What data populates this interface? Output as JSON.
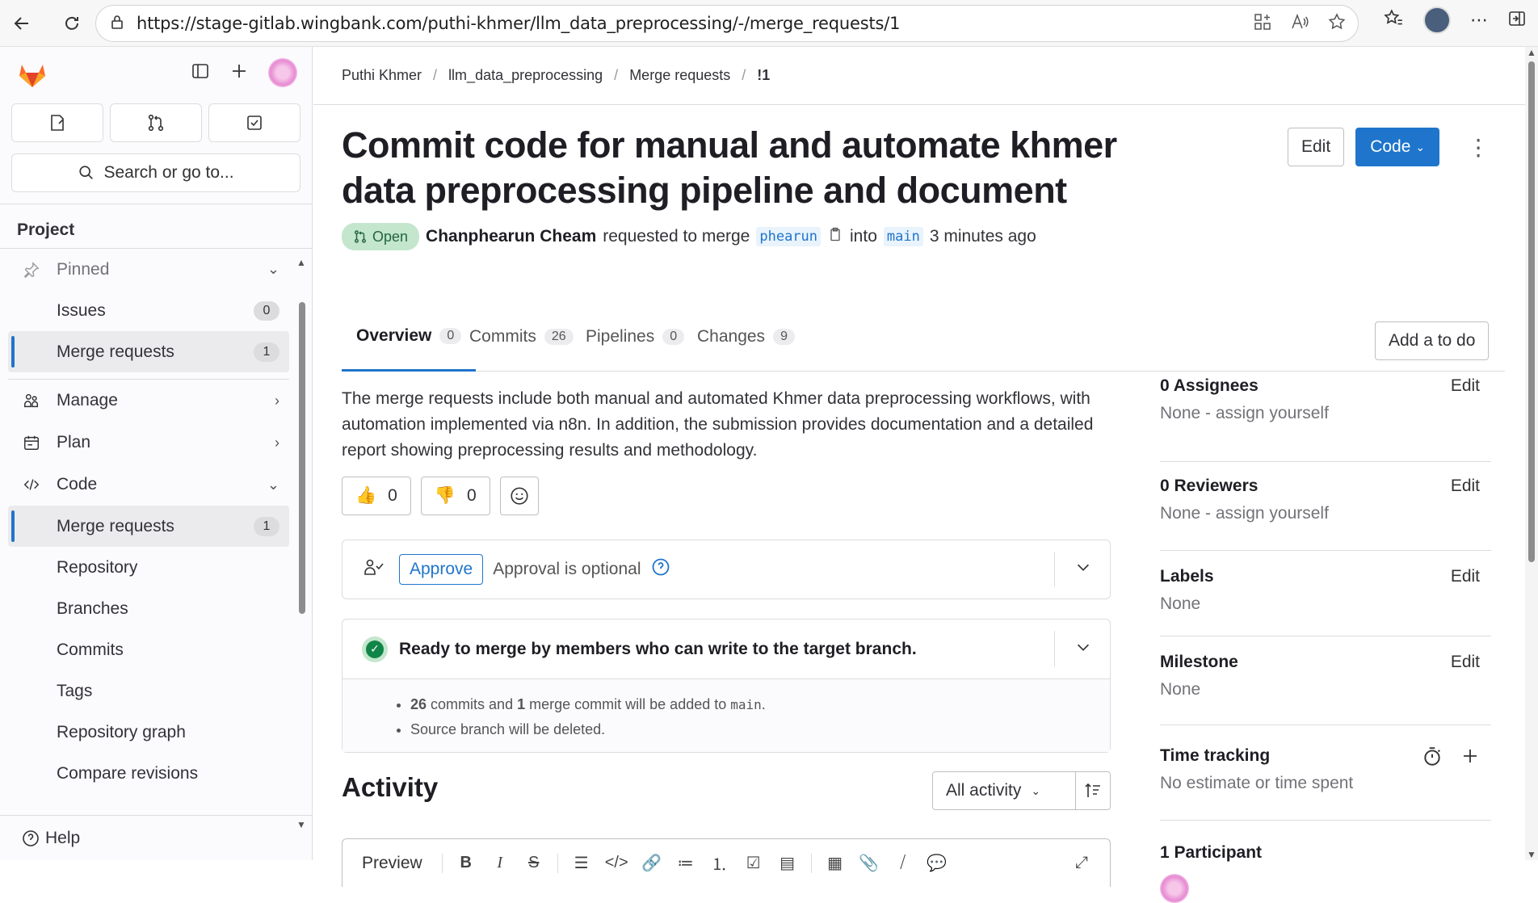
{
  "browser": {
    "url": "https://stage-gitlab.wingbank.com/puthi-khmer/llm_data_preprocessing/-/merge_requests/1"
  },
  "sidebar": {
    "search_placeholder": "Search or go to...",
    "section_title": "Project",
    "pinned_label": "Pinned",
    "pinned_items": [
      {
        "label": "Issues",
        "count": "0"
      },
      {
        "label": "Merge requests",
        "count": "1"
      }
    ],
    "groups": [
      {
        "label": "Manage",
        "icon": "users-icon"
      },
      {
        "label": "Plan",
        "icon": "calendar-icon"
      },
      {
        "label": "Code",
        "icon": "code-icon"
      }
    ],
    "code_items": [
      {
        "label": "Merge requests",
        "count": "1"
      },
      {
        "label": "Repository"
      },
      {
        "label": "Branches"
      },
      {
        "label": "Commits"
      },
      {
        "label": "Tags"
      },
      {
        "label": "Repository graph"
      },
      {
        "label": "Compare revisions"
      }
    ],
    "help_label": "Help"
  },
  "breadcrumb": [
    "Puthi Khmer",
    "llm_data_preprocessing",
    "Merge requests",
    "!1"
  ],
  "mr": {
    "title": "Commit code for manual and automate khmer data preprocessing pipeline and document",
    "edit_label": "Edit",
    "code_label": "Code",
    "status": "Open",
    "author": "Chanphearun Cheam",
    "requested_text": "requested to merge",
    "source_branch": "phearun",
    "into_text": "into",
    "target_branch": "main",
    "time": "3 minutes ago",
    "tabs": [
      {
        "label": "Overview",
        "count": "0"
      },
      {
        "label": "Commits",
        "count": "26"
      },
      {
        "label": "Pipelines",
        "count": "0"
      },
      {
        "label": "Changes",
        "count": "9"
      }
    ],
    "todo_label": "Add a to do",
    "description": "The merge requests include both manual and automated Khmer data preprocessing workflows, with automation implemented via n8n. In addition, the submission provides documentation and a detailed report showing preprocessing results and methodology.",
    "thumbs_up": "0",
    "thumbs_down": "0",
    "approve_label": "Approve",
    "approval_text": "Approval is optional",
    "merge_status": "Ready to merge by members who can write to the target branch.",
    "merge_commits_count": "26",
    "merge_commits_text": "commits and",
    "merge_commit_count": "1",
    "merge_commit_text": "merge commit will be added to",
    "merge_target": "main",
    "merge_delete_text": "Source branch will be deleted."
  },
  "activity": {
    "title": "Activity",
    "filter_label": "All activity",
    "editor_preview": "Preview"
  },
  "right_sidebar": {
    "assignees_title": "0 Assignees",
    "assignees_value": "None - assign yourself",
    "reviewers_title": "0 Reviewers",
    "reviewers_value": "None - assign yourself",
    "labels_title": "Labels",
    "labels_value": "None",
    "milestone_title": "Milestone",
    "milestone_value": "None",
    "time_title": "Time tracking",
    "time_value": "No estimate or time spent",
    "participants_title": "1 Participant",
    "edit_label": "Edit"
  },
  "colors": {
    "accent": "#1f75cb",
    "success": "#108548",
    "open_badge_bg": "#c3e6cd"
  }
}
